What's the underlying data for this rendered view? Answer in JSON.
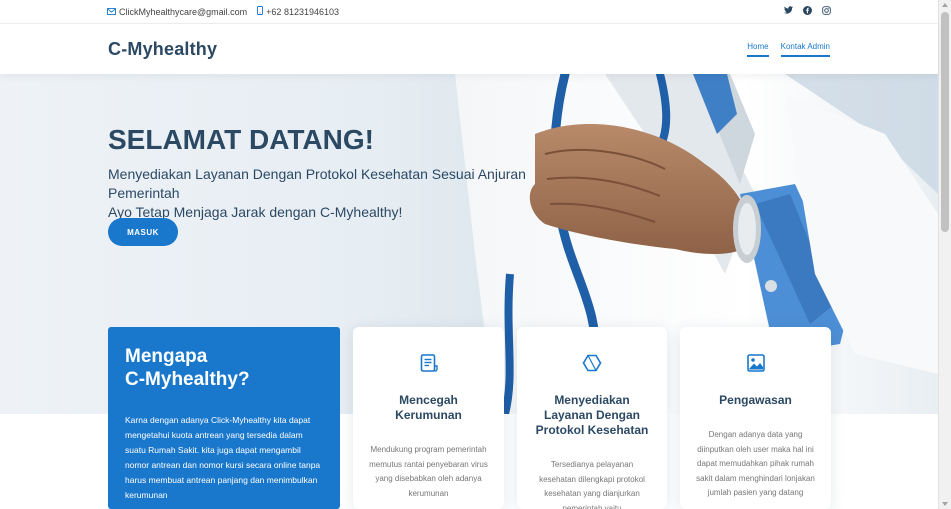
{
  "topbar": {
    "email": "ClickMyhealthycare@gmail.com",
    "phone": "+62 81231946103",
    "email_icon": "envelope-icon",
    "phone_icon": "phone-icon",
    "socials": [
      "twitter-icon",
      "facebook-icon",
      "instagram-icon"
    ]
  },
  "header": {
    "logo": "C-Myhealthy",
    "nav": [
      {
        "label": "Home",
        "active": true
      },
      {
        "label": "Kontak Admin",
        "active": false
      }
    ]
  },
  "hero": {
    "title": "SELAMAT DATANG!",
    "subtitle_line1": "Menyediakan Layanan Dengan Protokol Kesehatan Sesuai Anjuran Pemerintah",
    "subtitle_line2": "Ayo Tetap Menjaga Jarak dengan C-Myhealthy!",
    "button_label": "MASUK"
  },
  "why": {
    "title_line1": "Mengapa",
    "title_line2": "C-Myhealthy?",
    "text": "Karna dengan adanya Click-Myhealthy kita dapat mengetahui kuota antrean yang tersedia dalam suatu Rumah Sakit. kita juga dapat mengambil nomor antrean dan nomor kursi secara online tanpa harus membuat antrean panjang dan menimbulkan kerumunan"
  },
  "features": [
    {
      "icon": "document-icon",
      "title_line1": "Mencegah",
      "title_line2": "Kerumunan",
      "title_line3": "",
      "text": "Mendukung program pemerintah memutus rantai penyebaran virus yang disebabkan oleh adanya kerumunan"
    },
    {
      "icon": "hexagon-icon",
      "title_line1": "Menyediakan",
      "title_line2": "Layanan Dengan",
      "title_line3": "Protokol Kesehatan",
      "text": "Tersedianya pelayanan kesehatan dilengkapi protokol kesehatan yang dianjurkan pemerintah yaitu"
    },
    {
      "icon": "image-icon",
      "title_line1": "Pengawasan",
      "title_line2": "",
      "title_line3": "",
      "text": "Dengan adanya data yang diinputkan oleh user maka hal ini dapat memudahkan pihak rumah sakit dalam menghindari lonjakan jumlah pasien yang datang"
    }
  ],
  "colors": {
    "accent": "#1977cc",
    "heading": "#2c4964",
    "muted": "#777777"
  }
}
